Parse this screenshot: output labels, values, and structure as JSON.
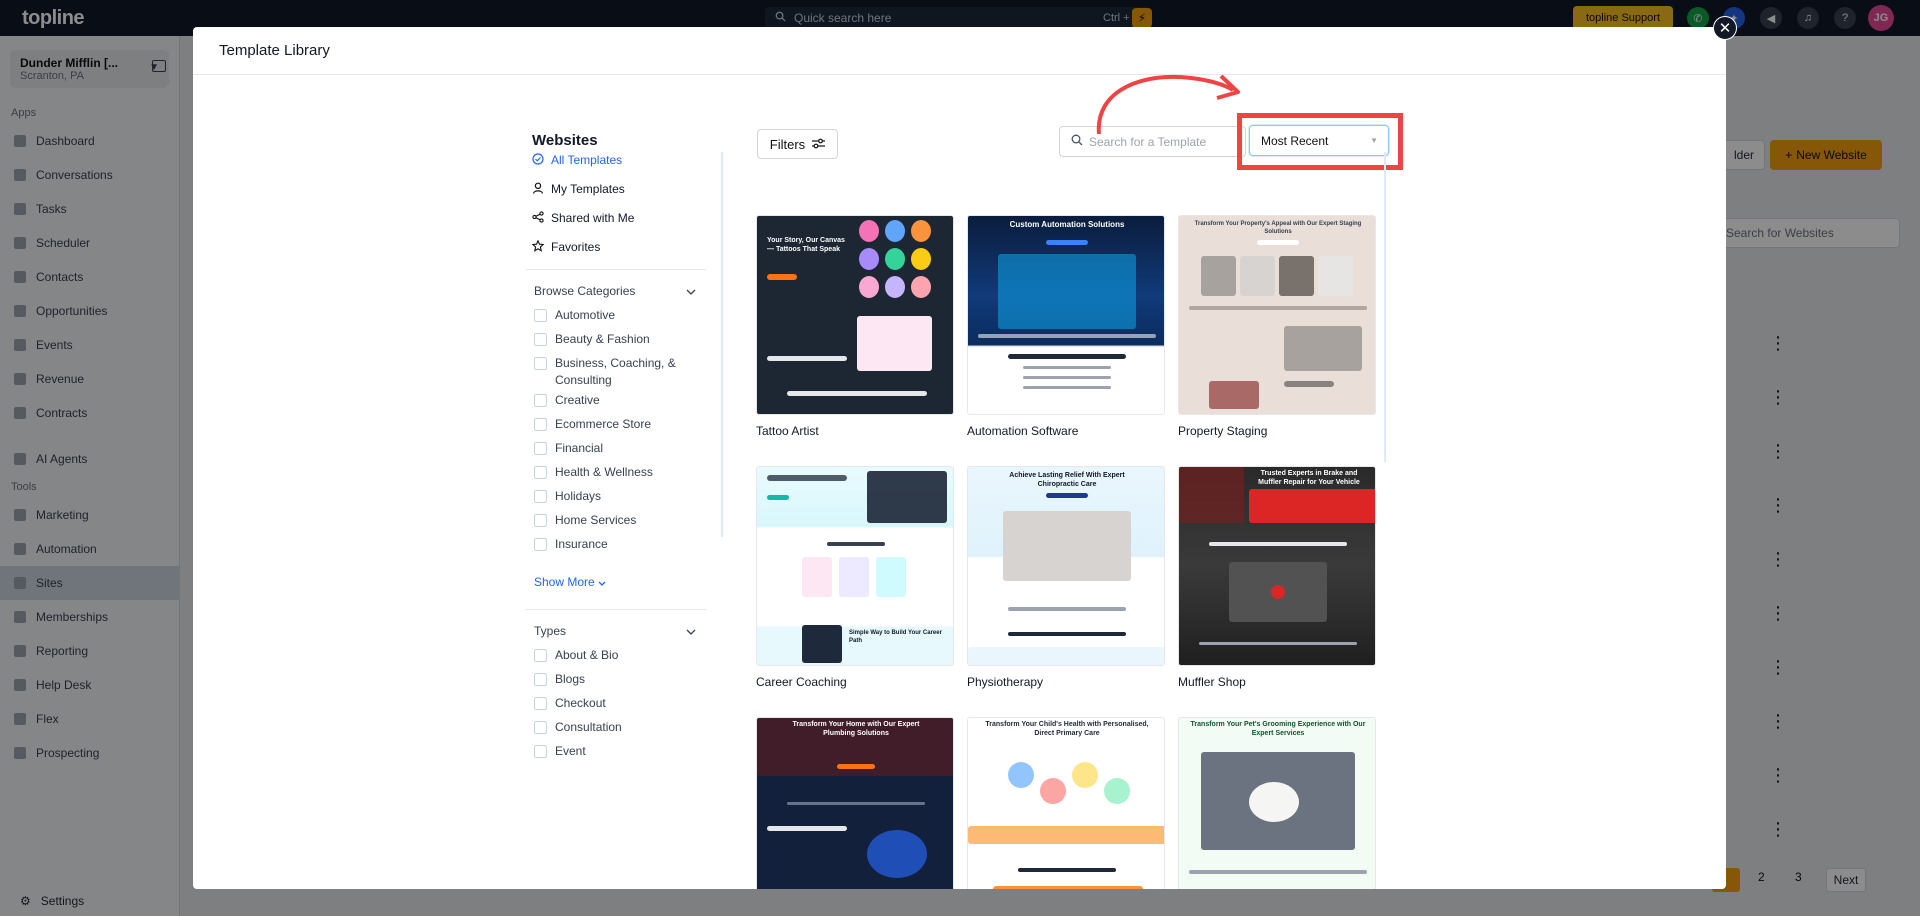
{
  "app": {
    "logo": "topline",
    "quick_search_placeholder": "Quick search here",
    "quick_search_shortcut": "Ctrl + K",
    "support_label": "topline Support",
    "avatar_initials": "JG",
    "account_name": "Dunder Mifflin [...",
    "account_location": "Scranton, PA"
  },
  "sidebar": {
    "apps_label": "Apps",
    "apps": [
      {
        "label": "Dashboard"
      },
      {
        "label": "Conversations"
      },
      {
        "label": "Tasks"
      },
      {
        "label": "Scheduler"
      },
      {
        "label": "Contacts"
      },
      {
        "label": "Opportunities"
      },
      {
        "label": "Events"
      },
      {
        "label": "Revenue"
      },
      {
        "label": "Contracts"
      }
    ],
    "ai_agents": "AI Agents",
    "tools_label": "Tools",
    "tools": [
      {
        "label": "Marketing"
      },
      {
        "label": "Automation"
      },
      {
        "label": "Sites"
      },
      {
        "label": "Memberships"
      },
      {
        "label": "Reporting"
      },
      {
        "label": "Help Desk"
      },
      {
        "label": "Flex"
      },
      {
        "label": "Prospecting"
      }
    ],
    "settings": "Settings"
  },
  "background": {
    "folder_btn": "lder",
    "new_website_btn": "New Website",
    "search_placeholder": "Search for Websites",
    "pager": [
      "2",
      "3"
    ],
    "next_btn": "Next"
  },
  "modal": {
    "title": "Template Library",
    "section_title": "Websites",
    "filters_label": "Filters",
    "search_placeholder": "Search for a Template",
    "sort_value": "Most Recent",
    "nav": [
      {
        "label": "All Templates",
        "icon": "check-circle-icon"
      },
      {
        "label": "My Templates",
        "icon": "user-icon"
      },
      {
        "label": "Shared with Me",
        "icon": "share-icon"
      },
      {
        "label": "Favorites",
        "icon": "star-icon"
      }
    ],
    "browse_categories_label": "Browse Categories",
    "categories": [
      {
        "label": "Automotive"
      },
      {
        "label": "Beauty & Fashion"
      },
      {
        "label": "Business, Coaching, & Consulting"
      },
      {
        "label": "Creative"
      },
      {
        "label": "Ecommerce Store"
      },
      {
        "label": "Financial"
      },
      {
        "label": "Health & Wellness"
      },
      {
        "label": "Holidays"
      },
      {
        "label": "Home Services"
      },
      {
        "label": "Insurance"
      }
    ],
    "show_more": "Show More",
    "types_label": "Types",
    "types": [
      {
        "label": "About & Bio"
      },
      {
        "label": "Blogs"
      },
      {
        "label": "Checkout"
      },
      {
        "label": "Consultation"
      },
      {
        "label": "Event"
      }
    ],
    "templates": [
      {
        "label": "Tattoo Artist",
        "headline": "Your Story, Our Canvas — Tattoos That Speak"
      },
      {
        "label": "Automation Software",
        "headline": "Custom Automation Solutions"
      },
      {
        "label": "Property Staging",
        "headline": "Transform Your Property's Appeal with Our Expert Staging Solutions"
      },
      {
        "label": "Career Coaching",
        "headline": "Simple Way to Build Your Career Path"
      },
      {
        "label": "Physiotherapy",
        "headline": "Achieve Lasting Relief With Expert Chiropractic Care"
      },
      {
        "label": "Muffler Shop",
        "headline": "Trusted Experts in Brake and Muffler Repair for Your Vehicle"
      },
      {
        "label": "",
        "headline": "Transform Your Home with Our Expert Plumbing Solutions"
      },
      {
        "label": "",
        "headline": "Transform Your Child's Health with Personalised, Direct Primary Care"
      },
      {
        "label": "",
        "headline": "Transform Your Pet's Grooming Experience with Our Expert Services"
      }
    ]
  },
  "colors": {
    "accent_blue": "#2563eb",
    "highlight_red": "#ef4444",
    "brand_yellow": "#f59e0b",
    "topbar": "#101828"
  }
}
